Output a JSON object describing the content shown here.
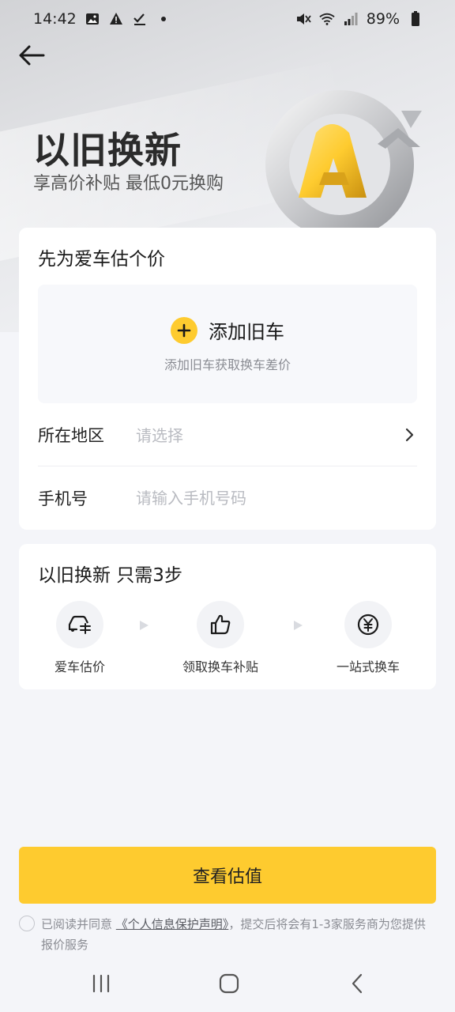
{
  "status_bar": {
    "time": "14:42",
    "battery": "89%"
  },
  "hero": {
    "title": "以旧换新",
    "subtitle": "享高价补贴 最低0元换购",
    "logo_letter": "A"
  },
  "estimate_card": {
    "title": "先为爱车估个价",
    "add_car_label": "添加旧车",
    "add_car_hint": "添加旧车获取换车差价",
    "region_label": "所在地区",
    "region_placeholder": "请选择",
    "phone_label": "手机号",
    "phone_placeholder": "请输入手机号码"
  },
  "steps_card": {
    "title": "以旧换新 只需3步",
    "steps": [
      {
        "label": "爱车估价",
        "icon": "car-price-icon"
      },
      {
        "label": "领取换车补贴",
        "icon": "thumbs-up-icon"
      },
      {
        "label": "一站式换车",
        "icon": "yuan-coin-icon"
      }
    ]
  },
  "cta": {
    "label": "查看估值"
  },
  "agreement": {
    "prefix": "已阅读并同意",
    "link": "《个人信息保护声明》",
    "suffix": "，提交后将会有1-3家服务商为您提供报价服务"
  },
  "colors": {
    "accent": "#fecb2f",
    "background": "#f4f5f9",
    "placeholder": "#b9bbc1",
    "hint": "#8a8c93"
  }
}
